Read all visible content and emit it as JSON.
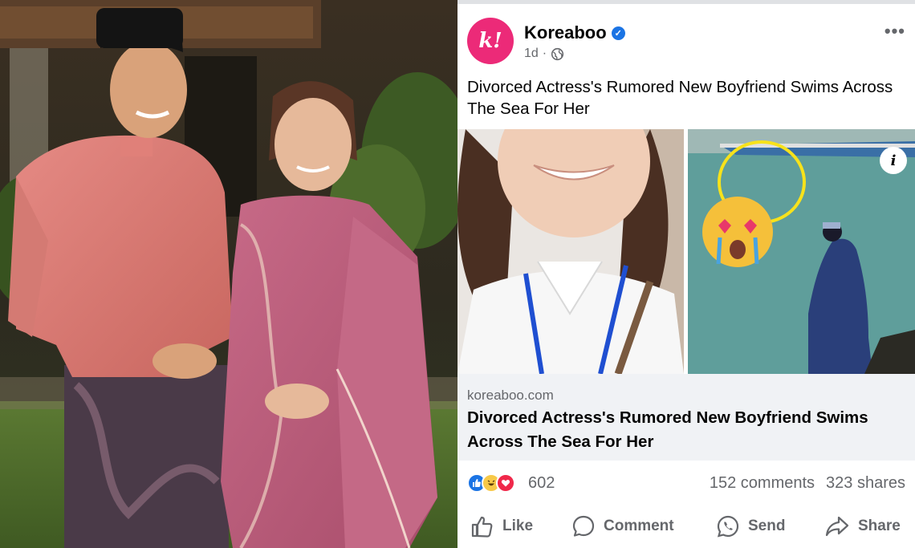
{
  "post": {
    "page_name": "Koreaboo",
    "avatar_letter": "k!",
    "verified_icon": "check-badge-icon",
    "time": "1d",
    "privacy_icon": "globe-icon",
    "more_label": "•••",
    "caption": "Divorced Actress's Rumored New Boyfriend Swims Across The Sea For Her",
    "info_label": "i",
    "link": {
      "domain": "koreaboo.com",
      "title": "Divorced Actress's Rumored New Boyfriend Swims Across The Sea For Her"
    },
    "reaction_icons": [
      "like-icon",
      "haha-icon",
      "love-icon"
    ],
    "reaction_count": "602",
    "comments": "152 comments",
    "shares": "323 shares",
    "actions": {
      "like": "Like",
      "comment": "Comment",
      "send": "Send",
      "share": "Share"
    }
  },
  "colors": {
    "brand": "#ec2a78",
    "facebook_blue": "#1b74e4",
    "secondary_text": "#65676b",
    "link_box": "#f0f2f5"
  }
}
